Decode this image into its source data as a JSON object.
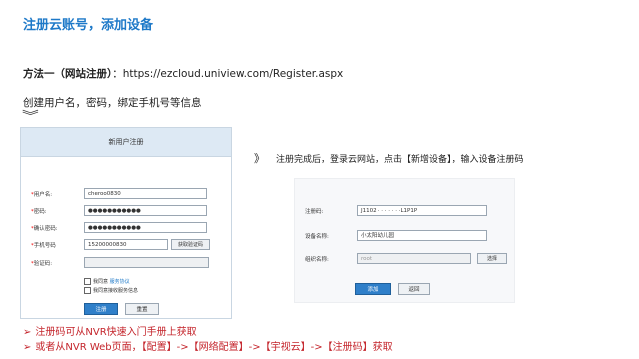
{
  "title": "注册云账号，添加设备",
  "method": {
    "label": "方法一（网站注册）",
    "separator": "：",
    "url": "https://ezcloud.uniview.com/Register.aspx"
  },
  "description": "创建用户名，密码，绑定手机号等信息",
  "down_chevron": "︾",
  "register_form": {
    "header": "新用户注册",
    "fields": [
      {
        "label": "用户名:",
        "value": "cheroo0830"
      },
      {
        "label": "密码:",
        "value": "●●●●●●●●●●●"
      },
      {
        "label": "确认密码:",
        "value": "●●●●●●●●●●●"
      },
      {
        "label": "手机号码",
        "value": "15200000830"
      },
      {
        "label": "验证码:",
        "value": ""
      }
    ],
    "get_code_button": "获取验证码",
    "agree_text": "我同意",
    "agree_link": "服务协议",
    "subscribe_text": "我同意接收服务信息",
    "register_button": "注册",
    "reset_button": "重置"
  },
  "right_chevron": "》",
  "right_text": "注册完成后，登录云网站，点击【新增设备】，输入设备注册码",
  "add_device_form": {
    "fields": [
      {
        "label": "注册码:",
        "value": "J1102 ·  ·  ·  ·  ·  ·  ·L1P1P"
      },
      {
        "label": "设备名称:",
        "value": "小太阳幼儿园"
      },
      {
        "label": "组织名称:",
        "value": "root"
      }
    ],
    "select_button": "选择",
    "add_button": "添加",
    "back_button": "返回"
  },
  "notes": [
    "注册码可从NVR快速入门手册上获取",
    "或者从NVR Web页面，【配置】->【网络配置】->【宇视云】->【注册码】获取"
  ],
  "note_marker": "➢"
}
